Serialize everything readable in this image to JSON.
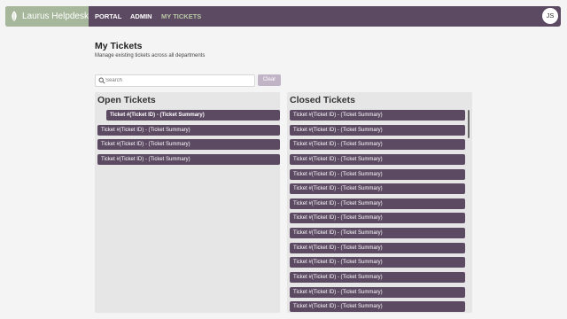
{
  "app": {
    "brand": "Laurus Helpdesk",
    "logo_icon": "leaf-icon"
  },
  "nav": [
    {
      "label": "PORTAL",
      "active": false
    },
    {
      "label": "ADMIN",
      "active": false
    },
    {
      "label": "MY TICKETS",
      "active": true
    }
  ],
  "user": {
    "initials": "JS"
  },
  "page": {
    "title": "My Tickets",
    "subtitle": "Manage existing tickets across all departments"
  },
  "search": {
    "placeholder": "Search",
    "value": "",
    "icon": "search-icon"
  },
  "clear_label": "Clear",
  "colors": {
    "primary": "#5c4a63",
    "accent": "#a7b79b",
    "panel_bg": "#e6e6e6",
    "clear_button": "#c2b4c7"
  },
  "open": {
    "title": "Open Tickets",
    "tickets": [
      {
        "label": "Ticket #(Ticket ID) - (Ticket Summary)",
        "badge": "!",
        "highlighted": true
      },
      {
        "label": "Ticket #(Ticket ID) - (Ticket Summary)"
      },
      {
        "label": "Ticket #(Ticket ID) - (Ticket Summary)"
      },
      {
        "label": "Ticket #(Ticket ID) - (Ticket Summary)"
      }
    ]
  },
  "closed": {
    "title": "Closed Tickets",
    "tickets": [
      {
        "label": "Ticket #(Ticket ID) - (Ticket Summary)"
      },
      {
        "label": "Ticket #(Ticket ID) - (Ticket Summary)"
      },
      {
        "label": "Ticket #(Ticket ID) - (Ticket Summary)"
      },
      {
        "label": "Ticket #(Ticket ID) - (Ticket Summary)"
      },
      {
        "label": "Ticket #(Ticket ID) - (Ticket Summary)"
      },
      {
        "label": "Ticket #(Ticket ID) - (Ticket Summary)"
      },
      {
        "label": "Ticket #(Ticket ID) - (Ticket Summary)"
      },
      {
        "label": "Ticket #(Ticket ID) - (Ticket Summary)"
      },
      {
        "label": "Ticket #(Ticket ID) - (Ticket Summary)"
      },
      {
        "label": "Ticket #(Ticket ID) - (Ticket Summary)"
      },
      {
        "label": "Ticket #(Ticket ID) - (Ticket Summary)"
      },
      {
        "label": "Ticket #(Ticket ID) - (Ticket Summary)"
      },
      {
        "label": "Ticket #(Ticket ID) - (Ticket Summary)"
      },
      {
        "label": "Ticket #(Ticket ID) - (Ticket Summary)"
      }
    ]
  }
}
